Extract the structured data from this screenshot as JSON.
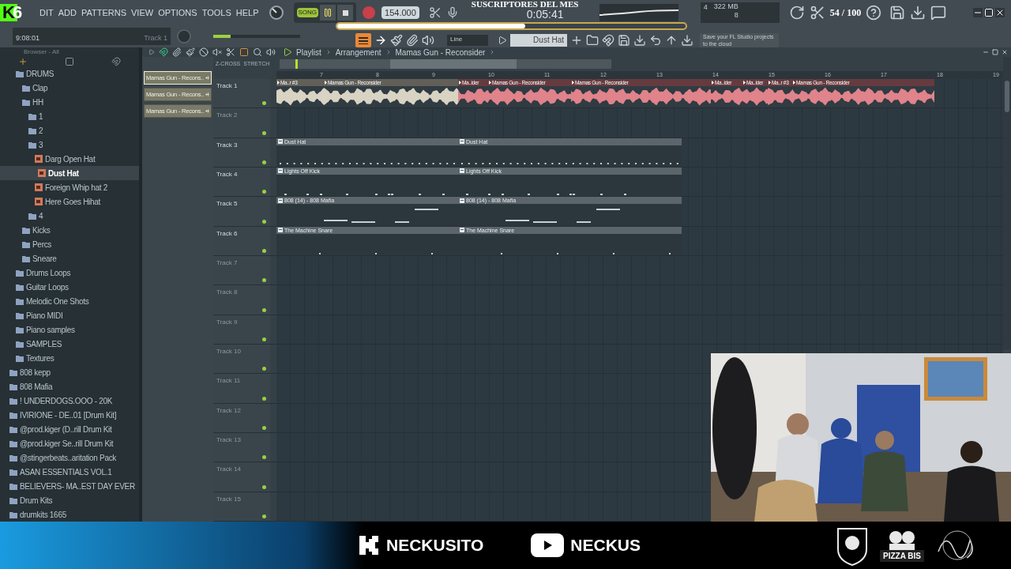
{
  "logo": {
    "letter": "K",
    "count": "6"
  },
  "menu": [
    "DIT",
    "ADD",
    "PATTERNS",
    "VIEW",
    "OPTIONS",
    "TOOLS",
    "HELP"
  ],
  "hint_panel": {
    "time": "9:08:01",
    "channel": "Track 1"
  },
  "transport": {
    "mode": "SONG",
    "playing": true,
    "tempo": "154.000"
  },
  "master_volume": {
    "level": 0.2
  },
  "overlay_goal": {
    "title": "SUSCRIPTORES DEL MES",
    "count": "54 / 100",
    "level": 0.54
  },
  "time_display": "0:05:41",
  "cpu": {
    "value": "4",
    "memory": "322 MB",
    "polyphony": "8"
  },
  "toolbar2": {
    "snap": "Line",
    "pattern": "Dust Hat",
    "news": "Save your FL Studio projects to the cloud"
  },
  "browser": {
    "title": "Browser - All",
    "scrolled_group": {
      "children": [
        {
          "label": "DRUMS",
          "kind": "folder",
          "selected": false,
          "children": [
            {
              "label": "Clap",
              "kind": "folder",
              "selected": false
            },
            {
              "label": "HH",
              "kind": "folder",
              "selected": false,
              "children": [
                {
                  "label": "1",
                  "kind": "folder",
                  "selected": false
                },
                {
                  "label": "2",
                  "kind": "folder",
                  "selected": false
                },
                {
                  "label": "3",
                  "kind": "folder",
                  "selected": false,
                  "children": [
                    {
                      "label": "Darg Open Hat",
                      "kind": "sample",
                      "selected": false
                    },
                    {
                      "label": "Dust Hat",
                      "kind": "sample",
                      "selected": true
                    },
                    {
                      "label": "Foreign Whip hat 2",
                      "kind": "sample",
                      "selected": false
                    },
                    {
                      "label": "Here Goes Hihat",
                      "kind": "sample",
                      "selected": false
                    }
                  ]
                },
                {
                  "label": "4",
                  "kind": "folder",
                  "selected": false
                }
              ]
            },
            {
              "label": "Kicks",
              "kind": "folder",
              "selected": false
            },
            {
              "label": "Percs",
              "kind": "folder",
              "selected": false
            },
            {
              "label": "Sneare",
              "kind": "folder",
              "selected": false
            }
          ]
        },
        {
          "label": "Drums Loops",
          "kind": "folder",
          "selected": false
        },
        {
          "label": "Guitar Loops",
          "kind": "folder",
          "selected": false
        },
        {
          "label": "Melodic One Shots",
          "kind": "folder",
          "selected": false
        },
        {
          "label": "Piano MIDI",
          "kind": "folder",
          "selected": false
        },
        {
          "label": "Piano samples",
          "kind": "folder",
          "selected": false
        },
        {
          "label": "SAMPLES",
          "kind": "folder",
          "selected": false
        },
        {
          "label": "Textures",
          "kind": "folder",
          "selected": false
        }
      ]
    },
    "items": [
      {
        "label": "808 kepp",
        "kind": "folder",
        "selected": false
      },
      {
        "label": "808 Mafia",
        "kind": "folder",
        "selected": false
      },
      {
        "label": "! UNDERDOGS.OOO - 20K",
        "kind": "folder",
        "selected": false
      },
      {
        "label": "IVIRIONE - DE..01 [Drum Kit]",
        "kind": "folder",
        "selected": false
      },
      {
        "label": "@prod.kiger (D..rill Drum Kit",
        "kind": "folder",
        "selected": false
      },
      {
        "label": "@prod.kiger Se..rill Drum Kit",
        "kind": "folder",
        "selected": false
      },
      {
        "label": "@stingerbeats..aritation Pack",
        "kind": "folder",
        "selected": false
      },
      {
        "label": "ASAN ESSENTIALS VOL.1",
        "kind": "folder",
        "selected": false
      },
      {
        "label": "BELIEVERS- MA..EST DAY EVER",
        "kind": "folder",
        "selected": false
      },
      {
        "label": "Drum Kits",
        "kind": "folder",
        "selected": false
      },
      {
        "label": "drumkits 1665",
        "kind": "folder",
        "selected": false
      }
    ]
  },
  "picker": [
    {
      "label": "Mamas Gun - Recons..",
      "selected": true
    },
    {
      "label": "Mamas Gun - Recons..",
      "selected": false
    },
    {
      "label": "Mamas Gun - Recons..",
      "selected": false
    }
  ],
  "playlist": {
    "breadcrumb": [
      "Playlist",
      "Arrangement",
      "Mamas Gun - Reconsider"
    ],
    "options": [
      "Z-CROSS",
      "STRETCH"
    ],
    "ruler": [
      "7",
      "8",
      "9",
      "10",
      "11",
      "12",
      "13",
      "14",
      "15",
      "16",
      "17",
      "18",
      "19"
    ],
    "tracks": [
      {
        "name": "Track 1",
        "active": true,
        "kind": "audio",
        "clips": [
          {
            "title": "Ma..r #3",
            "color": "#d8d3c3"
          },
          {
            "title": "Mamas Gun - Reconsider",
            "color": "#d8d3c3"
          },
          {
            "title": "Ma..ider",
            "color": "#e0838b"
          },
          {
            "title": "Mamas Gun - Reconsider",
            "color": "#e0838b"
          },
          {
            "title": "Mamas Gun - Reconsider",
            "color": "#e0838b"
          },
          {
            "title": "Ma..ider",
            "color": "#e0838b"
          },
          {
            "title": "Ma..ider",
            "color": "#e0838b"
          },
          {
            "title": "Ma..r #3",
            "color": "#e0838b"
          },
          {
            "title": "Mamas Gun - Reconsider",
            "color": "#e0838b"
          }
        ]
      },
      {
        "name": "Track 2",
        "active": false,
        "kind": "empty"
      },
      {
        "name": "Track 3",
        "active": true,
        "kind": "pattern",
        "clips": [
          {
            "title": "Dust Hat"
          },
          {
            "title": "Dust Hat"
          }
        ]
      },
      {
        "name": "Track 4",
        "active": true,
        "kind": "pattern",
        "clips": [
          {
            "title": "Lights Off Kick"
          },
          {
            "title": "Lights Off Kick"
          }
        ]
      },
      {
        "name": "Track 5",
        "active": true,
        "kind": "pattern",
        "clips": [
          {
            "title": "808 (14) - 808 Mafia"
          },
          {
            "title": "808 (14) - 808 Mafia"
          }
        ]
      },
      {
        "name": "Track 6",
        "active": true,
        "kind": "pattern",
        "clips": [
          {
            "title": "The Machine Snare"
          },
          {
            "title": "The Machine Snare"
          }
        ]
      },
      {
        "name": "Track 7",
        "active": false,
        "kind": "empty"
      },
      {
        "name": "Track 8",
        "active": false,
        "kind": "empty"
      },
      {
        "name": "Track 9",
        "active": false,
        "kind": "empty"
      },
      {
        "name": "Track 10",
        "active": false,
        "kind": "empty"
      },
      {
        "name": "Track 11",
        "active": false,
        "kind": "empty"
      },
      {
        "name": "Track 12",
        "active": false,
        "kind": "empty"
      },
      {
        "name": "Track 13",
        "active": false,
        "kind": "empty"
      },
      {
        "name": "Track 14",
        "active": false,
        "kind": "empty"
      },
      {
        "name": "Track 15",
        "active": false,
        "kind": "empty"
      }
    ]
  },
  "webcam": {
    "kind": "picture"
  },
  "socials": [
    {
      "kind": "kick",
      "handle": "NECKUSITO"
    },
    {
      "kind": "youtube",
      "handle": "NECKUS"
    }
  ],
  "sponsors": [
    {
      "kind": "crest"
    },
    {
      "kind": "badge",
      "label": "PIZZA BIS"
    },
    {
      "kind": "signature"
    }
  ]
}
